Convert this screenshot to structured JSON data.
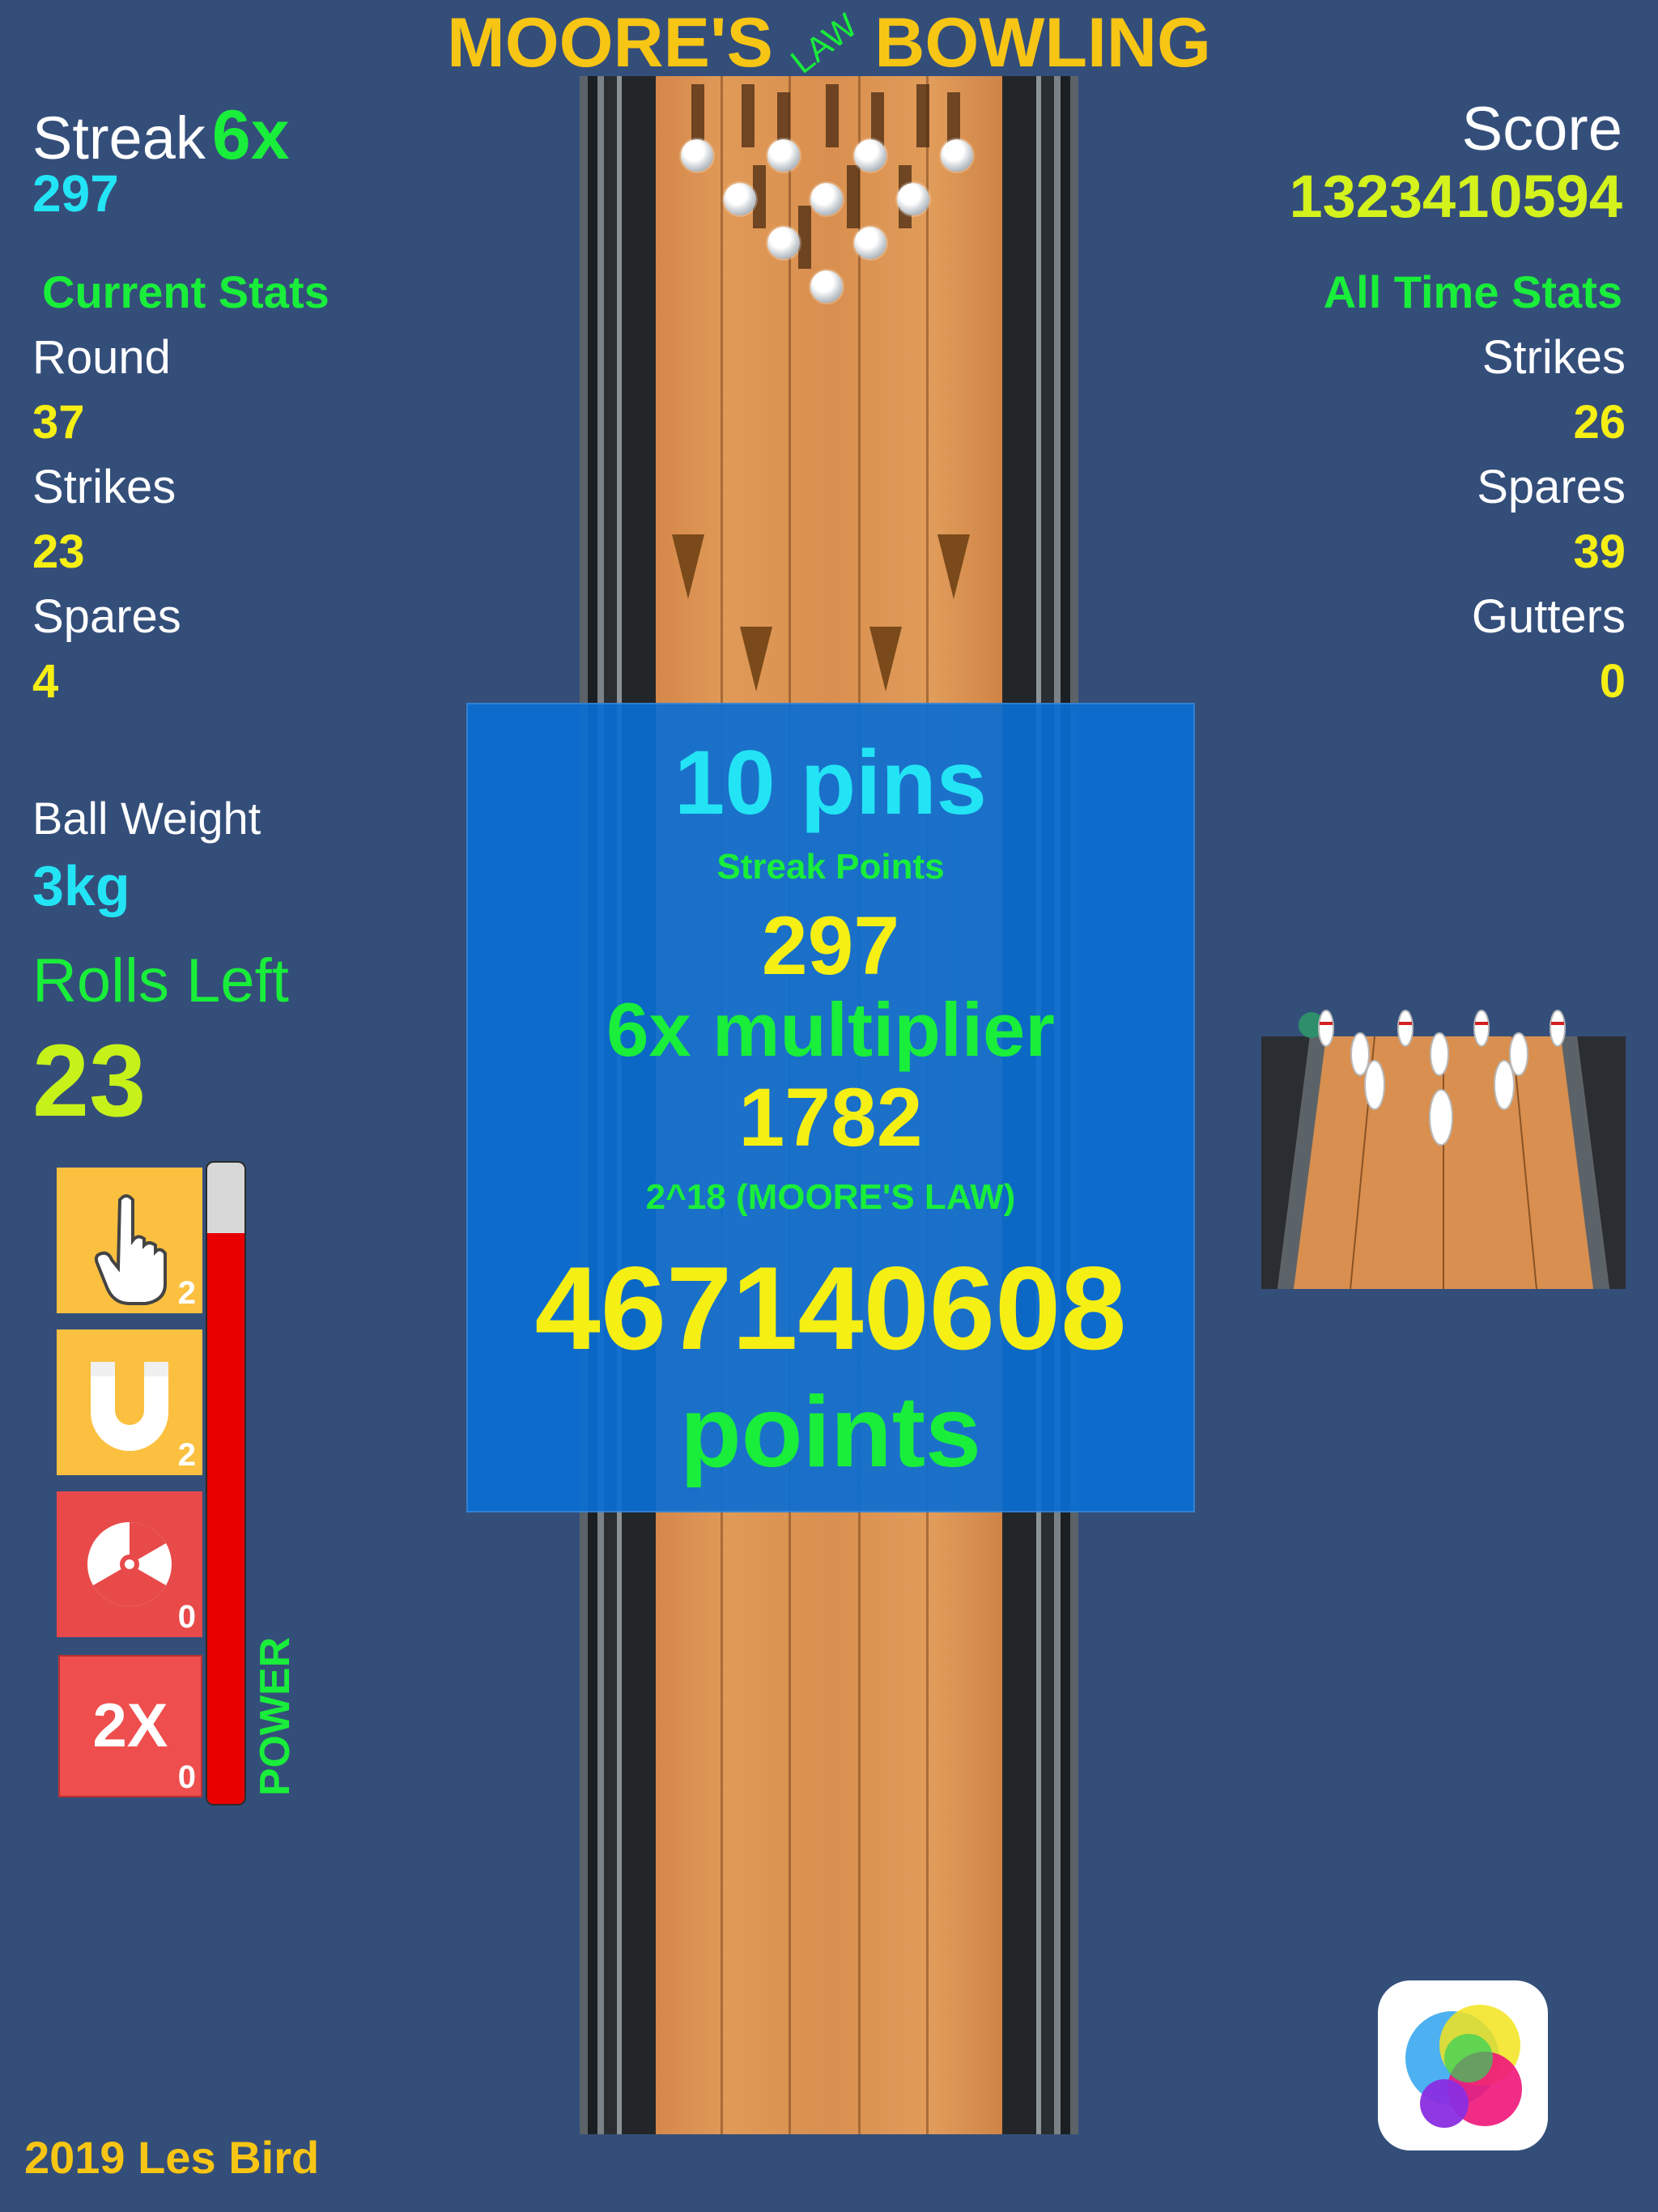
{
  "title": {
    "left": "MOORE'S",
    "middle": "LAW",
    "right": "BOWLING"
  },
  "streak": {
    "label": "Streak",
    "multiplier": "6x",
    "value": "297"
  },
  "score": {
    "label": "Score",
    "value": "1323410594"
  },
  "current_stats": {
    "heading": "Current Stats",
    "items": [
      {
        "label": "Round",
        "value": "37"
      },
      {
        "label": "Strikes",
        "value": "23"
      },
      {
        "label": "Spares",
        "value": "4"
      }
    ]
  },
  "all_time_stats": {
    "heading": "All Time Stats",
    "items": [
      {
        "label": "Strikes",
        "value": "26"
      },
      {
        "label": "Spares",
        "value": "39"
      },
      {
        "label": "Gutters",
        "value": "0"
      }
    ]
  },
  "ball_weight": {
    "label": "Ball Weight",
    "value": "3kg"
  },
  "rolls_left": {
    "label": "Rolls Left",
    "value": "23"
  },
  "powerups": [
    {
      "icon": "finger-icon",
      "count": "2",
      "color": "#fbc040"
    },
    {
      "icon": "magnet-icon",
      "count": "2",
      "color": "#fbc040"
    },
    {
      "icon": "radiation-icon",
      "count": "0",
      "color": "#e84a4a"
    },
    {
      "icon": "double-icon",
      "label": "2X",
      "count": "0",
      "color": "#ee4e4e"
    }
  ],
  "power": {
    "label": "POWER",
    "level": 0.89
  },
  "result": {
    "pins": "10 pins",
    "streak_points_label": "Streak Points",
    "streak_points": "297",
    "multiplier": "6x multiplier",
    "subtotal": "1782",
    "moores_law": "2^18 (MOORE'S LAW)",
    "total": "467140608",
    "points_label": "points"
  },
  "footer": {
    "credit": "2019 Les Bird"
  },
  "colors": {
    "background": "#344e7a",
    "accent_green": "#19ee3a",
    "accent_yellow": "#f5ef14",
    "accent_cyan": "#22e4f5",
    "title_gold": "#f7c514",
    "overlay_blue": "#0a6ed2"
  }
}
